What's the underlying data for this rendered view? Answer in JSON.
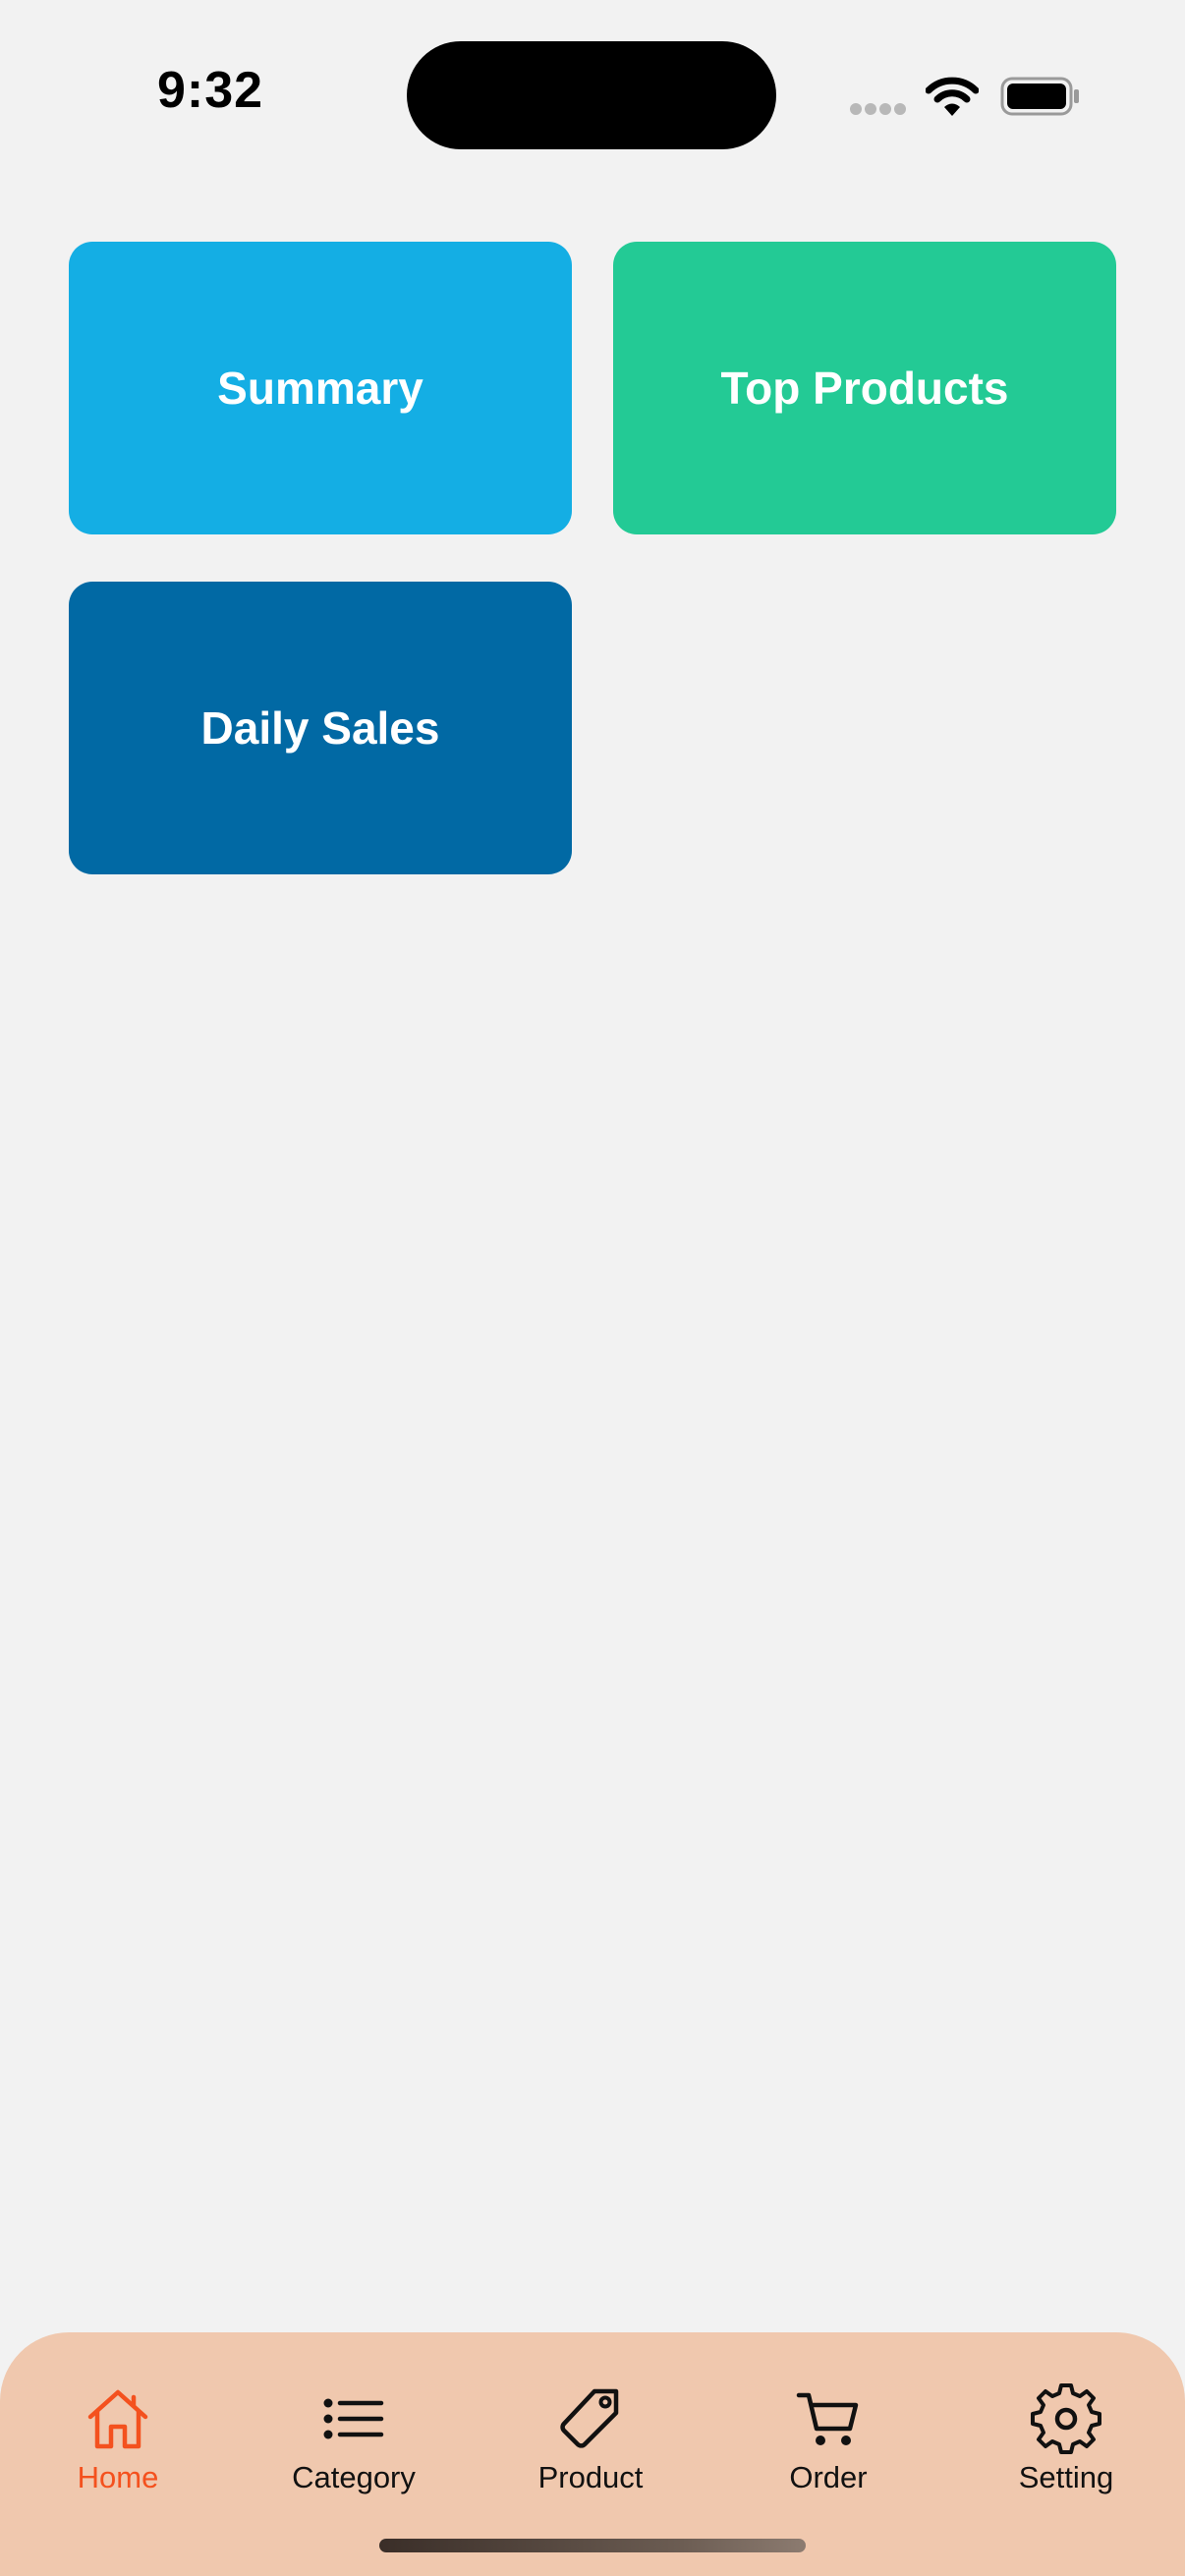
{
  "status_bar": {
    "time": "9:32"
  },
  "tiles": [
    {
      "label": "Summary",
      "color": "#14aee4"
    },
    {
      "label": "Top Products",
      "color": "#23ca95"
    },
    {
      "label": "Daily Sales",
      "color": "#0169a4"
    }
  ],
  "bottom_nav": {
    "active": "Home",
    "active_color": "#f4511e",
    "background": "#f0c8ae",
    "items": [
      {
        "label": "Home",
        "icon": "home-icon"
      },
      {
        "label": "Category",
        "icon": "list-icon"
      },
      {
        "label": "Product",
        "icon": "tag-icon"
      },
      {
        "label": "Order",
        "icon": "cart-icon"
      },
      {
        "label": "Setting",
        "icon": "gear-icon"
      }
    ]
  }
}
